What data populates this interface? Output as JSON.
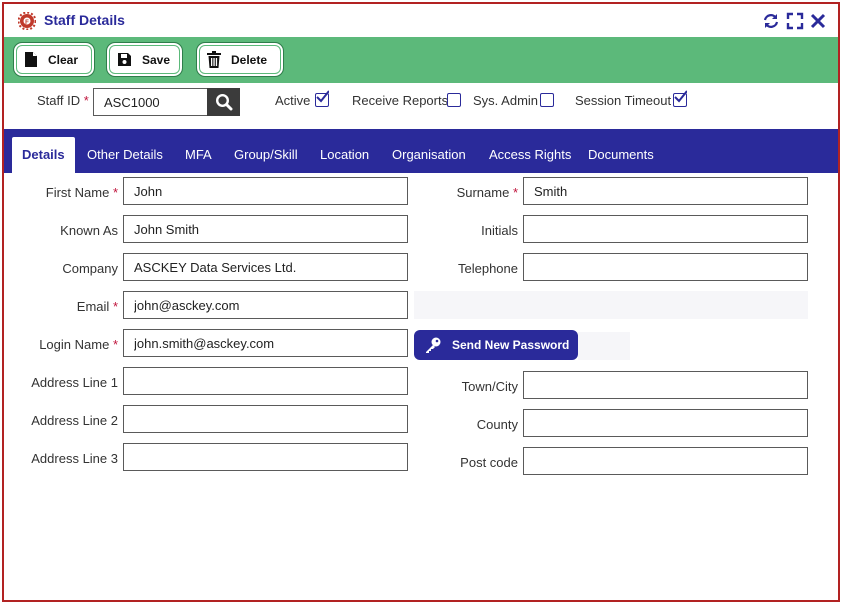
{
  "window": {
    "title": "Staff Details",
    "app_icon": "gear-logo-icon",
    "controls": [
      "refresh-icon",
      "maximize-icon",
      "close-icon"
    ]
  },
  "toolbar": {
    "clear_label": "Clear",
    "save_label": "Save",
    "delete_label": "Delete"
  },
  "id_row": {
    "staff_id_label": "Staff ID",
    "staff_id_value": "ASC1000",
    "active_label": "Active",
    "active_checked": true,
    "receive_reports_label": "Receive Reports",
    "receive_reports_checked": false,
    "sys_admin_label": "Sys. Admin",
    "sys_admin_checked": false,
    "session_timeout_label": "Session Timeout",
    "session_timeout_checked": true
  },
  "tabs": [
    {
      "label": "Details",
      "active": true
    },
    {
      "label": "Other Details"
    },
    {
      "label": "MFA"
    },
    {
      "label": "Group/Skill"
    },
    {
      "label": "Location"
    },
    {
      "label": "Organisation"
    },
    {
      "label": "Access Rights"
    },
    {
      "label": "Documents"
    }
  ],
  "form": {
    "first_name": {
      "label": "First Name",
      "value": "John",
      "required": true
    },
    "surname": {
      "label": "Surname",
      "value": "Smith",
      "required": true
    },
    "known_as": {
      "label": "Known As",
      "value": "John Smith"
    },
    "initials": {
      "label": "Initials",
      "value": ""
    },
    "company": {
      "label": "Company",
      "value": "ASCKEY Data Services Ltd."
    },
    "telephone": {
      "label": "Telephone",
      "value": ""
    },
    "email": {
      "label": "Email",
      "value": "john@asckey.com",
      "required": true
    },
    "login_name": {
      "label": "Login Name",
      "value": "john.smith@asckey.com",
      "required": true
    },
    "send_password_label": "Send New Password",
    "address1": {
      "label": "Address Line 1",
      "value": ""
    },
    "address2": {
      "label": "Address Line 2",
      "value": ""
    },
    "address3": {
      "label": "Address Line 3",
      "value": ""
    },
    "town": {
      "label": "Town/City",
      "value": ""
    },
    "county": {
      "label": "County",
      "value": ""
    },
    "postcode": {
      "label": "Post code",
      "value": ""
    }
  },
  "colors": {
    "accent": "#2a2a9a",
    "toolbar": "#5cb97a",
    "window_border": "#b22222",
    "required": "#c0143c"
  }
}
